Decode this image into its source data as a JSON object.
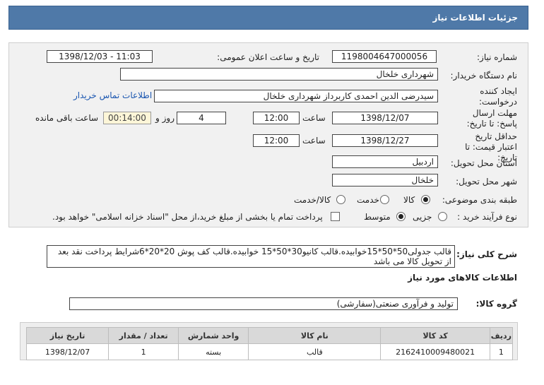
{
  "header": {
    "title": "جزئیات اطلاعات نیاز"
  },
  "form": {
    "need_number_label": "شماره نیاز:",
    "need_number": "1198004647000056",
    "announce_label": "تاریخ و ساعت اعلان عمومی:",
    "announce_value": "1398/12/03 - 11:03",
    "buyer_label": "نام دستگاه خریدار:",
    "buyer": "شهرداری خلخال",
    "creator_label": "ایجاد کننده درخواست:",
    "creator": "سیدرضی الدین  احمدی کاربرداز شهرداری خلخال",
    "contact_link": "اطلاعات تماس خریدار",
    "deadline_label": "مهلت ارسال پاسخ: تا تاریخ:",
    "deadline_date": "1398/12/07",
    "time_label": "ساعت",
    "deadline_time": "12:00",
    "days_value": "4",
    "days_label": "روز و",
    "remaining_time": "00:14:00",
    "remaining_label": "ساعت باقی مانده",
    "validity_label": "حداقل تاریخ اعتبار قیمت: تا تاریخ:",
    "validity_date": "1398/12/27",
    "validity_time": "12:00",
    "province_label": "استان محل تحویل:",
    "province": "اردبیل",
    "city_label": "شهر محل تحویل:",
    "city": "خلخال",
    "category_label": "طبقه بندی موضوعی:",
    "category_options": [
      "کالا",
      "خدمت",
      "کالا/خدمت"
    ],
    "category_selected": "کالا",
    "process_label": "نوع فرآیند خرید :",
    "process_options": [
      "جزیی",
      "متوسط"
    ],
    "process_selected": "متوسط",
    "payment_note": "پرداخت تمام یا بخشی از مبلغ خرید،از محل \"اسناد خزانه اسلامی\" خواهد بود."
  },
  "description": {
    "label": "شرح کلی نیاز:",
    "text": "قالب جدولی50*50*15خوابیده.قالب کانیو30*50*15 خوابیده.قالب کف پوش 20*20*6شرایط پرداخت نقد بعد از تحویل کالا می باشد"
  },
  "goods": {
    "section_title": "اطلاعات کالاهای مورد نیاز",
    "group_label": "گروه کالا:",
    "group_value": "تولید و فرآوری صنعتی(سفارشی)",
    "columns": [
      "ردیف",
      "کد کالا",
      "نام کالا",
      "واحد شمارش",
      "تعداد / مقدار",
      "تاریخ نیاز"
    ],
    "rows": [
      [
        "1",
        "2162410009480021",
        "قالب",
        "بسته",
        "1",
        "1398/12/07"
      ]
    ]
  }
}
